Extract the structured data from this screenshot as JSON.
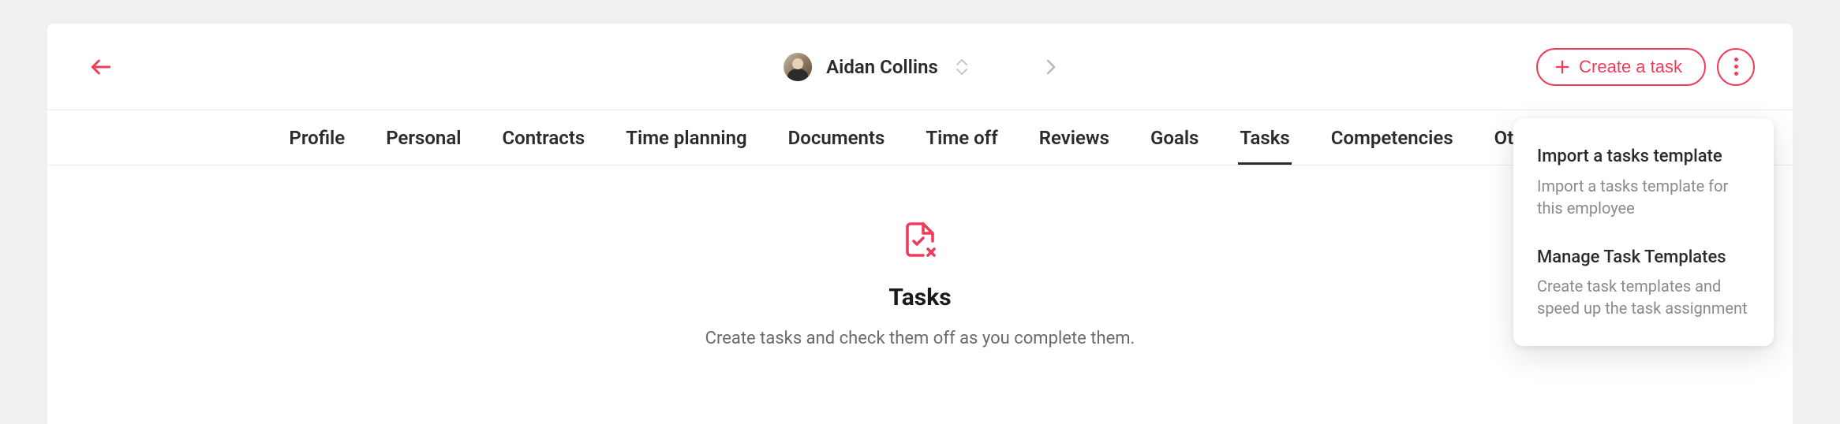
{
  "header": {
    "user_name": "Aidan Collins",
    "create_task_label": "Create a task"
  },
  "tabs": [
    {
      "label": "Profile",
      "active": false
    },
    {
      "label": "Personal",
      "active": false
    },
    {
      "label": "Contracts",
      "active": false
    },
    {
      "label": "Time planning",
      "active": false
    },
    {
      "label": "Documents",
      "active": false
    },
    {
      "label": "Time off",
      "active": false
    },
    {
      "label": "Reviews",
      "active": false
    },
    {
      "label": "Goals",
      "active": false
    },
    {
      "label": "Tasks",
      "active": true
    },
    {
      "label": "Competencies",
      "active": false
    },
    {
      "label": "Others",
      "active": false
    }
  ],
  "empty_state": {
    "title": "Tasks",
    "subtitle": "Create tasks and check them off as you complete them."
  },
  "dropdown": {
    "items": [
      {
        "title": "Import a tasks template",
        "desc": "Import a tasks template for this employee"
      },
      {
        "title": "Manage Task Templates",
        "desc": "Create task templates and speed up the task assignment"
      }
    ]
  },
  "colors": {
    "accent": "#ef3c5b"
  }
}
